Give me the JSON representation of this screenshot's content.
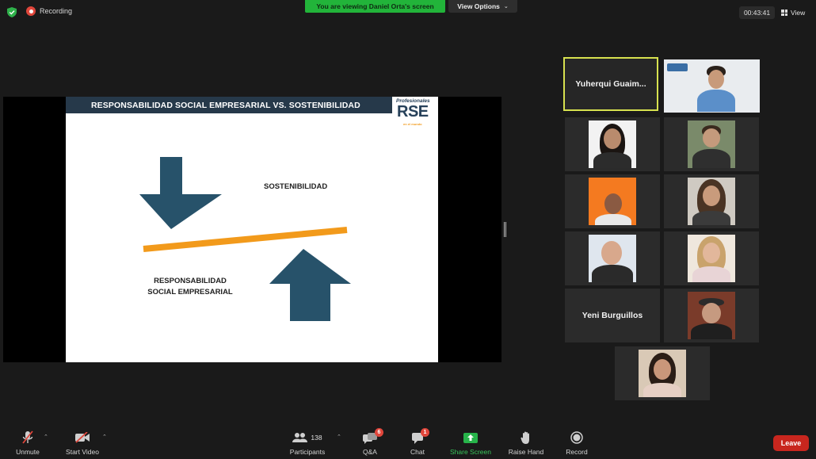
{
  "top_bar": {
    "recording_label": "Recording",
    "viewing_banner": "You are viewing Daniel Orta's screen",
    "view_options_label": "View Options",
    "timer": "00:43:41",
    "view_label": "View"
  },
  "slide": {
    "title": "RESPONSABILIDAD SOCIAL EMPRESARIAL VS. SOSTENIBILIDAD",
    "logo_top": "Profesionales",
    "logo_main": "RSE",
    "logo_sub": "en el mundo",
    "label_top": "SOSTENIBILIDAD",
    "label_bottom": "RESPONSABILIDAD SOCIAL EMPRESARIAL"
  },
  "gallery": {
    "name_tiles": {
      "yuherqui": "Yuherqui  Guaim...",
      "yeni": "Yeni Burguillos"
    }
  },
  "toolbar": {
    "unmute": "Unmute",
    "start_video": "Start Video",
    "participants": "Participants",
    "participants_count": "138",
    "qa": "Q&A",
    "qa_badge": "6",
    "chat": "Chat",
    "chat_badge": "1",
    "share_screen": "Share Screen",
    "raise_hand": "Raise Hand",
    "record": "Record",
    "leave": "Leave"
  },
  "colors": {
    "background": "#1a1a1a",
    "banner_green": "#22b43a",
    "active_speaker_border": "#d7e14f",
    "slide_header": "#26394a",
    "arrow": "#27526a",
    "bar_orange": "#f29a1b",
    "leave_red": "#c8261e"
  }
}
